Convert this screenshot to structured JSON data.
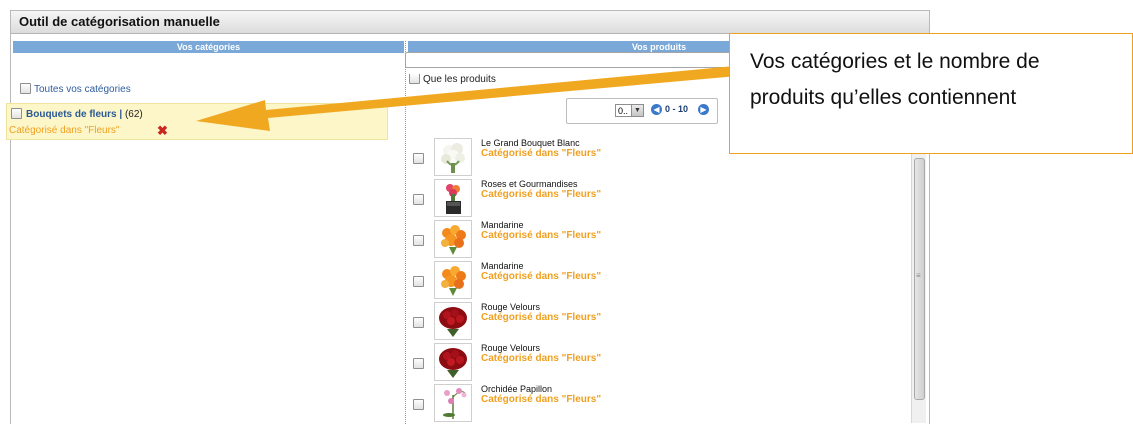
{
  "window": {
    "title": "Outil de catégorisation manuelle"
  },
  "columns": {
    "left_header": "Vos catégories",
    "right_header": "Vos produits"
  },
  "categories_panel": {
    "all_label": "Toutes vos catégories",
    "items": [
      {
        "name": "Bouquets de fleurs |",
        "count": "(62)",
        "status": "Catégorisé dans \"Fleurs\""
      }
    ]
  },
  "products_panel": {
    "filter_label": "Que les produits",
    "per_page_value": "0..",
    "range_text": "0 - 10",
    "items": [
      {
        "name": "Le Grand Bouquet Blanc",
        "status": "Catégorisé dans \"Fleurs\"",
        "image_icon": "white-bouquet"
      },
      {
        "name": "Roses et Gourmandises",
        "status": "Catégorisé dans \"Fleurs\"",
        "image_icon": "rose-box"
      },
      {
        "name": "Mandarine",
        "status": "Catégorisé dans \"Fleurs\"",
        "image_icon": "orange-bouquet"
      },
      {
        "name": "Mandarine",
        "status": "Catégorisé dans \"Fleurs\"",
        "image_icon": "orange-bouquet"
      },
      {
        "name": "Rouge Velours",
        "status": "Catégorisé dans \"Fleurs\"",
        "image_icon": "red-roses"
      },
      {
        "name": "Rouge Velours",
        "status": "Catégorisé dans \"Fleurs\"",
        "image_icon": "red-roses"
      },
      {
        "name": "Orchidée Papillon",
        "status": "Catégorisé dans \"Fleurs\"",
        "image_icon": "orchid"
      }
    ]
  },
  "callout": {
    "line1": "Vos catégories et le nombre de",
    "line2": "produits qu’elles contiennent"
  },
  "colors": {
    "header_blue": "#79a8d9",
    "status_orange": "#f0a020",
    "category_highlight": "#fdf6c8",
    "remove_red": "#c8281e"
  }
}
